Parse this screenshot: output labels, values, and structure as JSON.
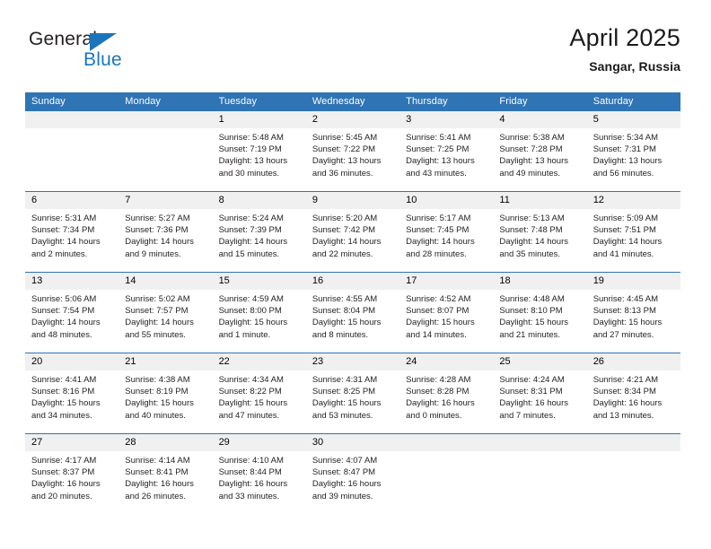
{
  "logo": {
    "word_top": "General",
    "word_bottom": "Blue",
    "triangle_color": "#1b75bb"
  },
  "header": {
    "title": "April 2025",
    "subtitle": "Sangar, Russia"
  },
  "colors": {
    "header_blue": "#2f74b5",
    "daynum_band": "#f0f0f0",
    "text": "#231f20"
  },
  "weekdays": [
    "Sunday",
    "Monday",
    "Tuesday",
    "Wednesday",
    "Thursday",
    "Friday",
    "Saturday"
  ],
  "labels": {
    "sunrise": "Sunrise:",
    "sunset": "Sunset:",
    "daylight": "Daylight:"
  },
  "weeks": [
    [
      {
        "day": "",
        "empty": true,
        "sunrise": "",
        "sunset": "",
        "daylight1": "",
        "daylight2": ""
      },
      {
        "day": "",
        "empty": true,
        "sunrise": "",
        "sunset": "",
        "daylight1": "",
        "daylight2": ""
      },
      {
        "day": "1",
        "sunrise": "Sunrise: 5:48 AM",
        "sunset": "Sunset: 7:19 PM",
        "daylight1": "Daylight: 13 hours",
        "daylight2": "and 30 minutes."
      },
      {
        "day": "2",
        "sunrise": "Sunrise: 5:45 AM",
        "sunset": "Sunset: 7:22 PM",
        "daylight1": "Daylight: 13 hours",
        "daylight2": "and 36 minutes."
      },
      {
        "day": "3",
        "sunrise": "Sunrise: 5:41 AM",
        "sunset": "Sunset: 7:25 PM",
        "daylight1": "Daylight: 13 hours",
        "daylight2": "and 43 minutes."
      },
      {
        "day": "4",
        "sunrise": "Sunrise: 5:38 AM",
        "sunset": "Sunset: 7:28 PM",
        "daylight1": "Daylight: 13 hours",
        "daylight2": "and 49 minutes."
      },
      {
        "day": "5",
        "sunrise": "Sunrise: 5:34 AM",
        "sunset": "Sunset: 7:31 PM",
        "daylight1": "Daylight: 13 hours",
        "daylight2": "and 56 minutes."
      }
    ],
    [
      {
        "day": "6",
        "sunrise": "Sunrise: 5:31 AM",
        "sunset": "Sunset: 7:34 PM",
        "daylight1": "Daylight: 14 hours",
        "daylight2": "and 2 minutes."
      },
      {
        "day": "7",
        "sunrise": "Sunrise: 5:27 AM",
        "sunset": "Sunset: 7:36 PM",
        "daylight1": "Daylight: 14 hours",
        "daylight2": "and 9 minutes."
      },
      {
        "day": "8",
        "sunrise": "Sunrise: 5:24 AM",
        "sunset": "Sunset: 7:39 PM",
        "daylight1": "Daylight: 14 hours",
        "daylight2": "and 15 minutes."
      },
      {
        "day": "9",
        "sunrise": "Sunrise: 5:20 AM",
        "sunset": "Sunset: 7:42 PM",
        "daylight1": "Daylight: 14 hours",
        "daylight2": "and 22 minutes."
      },
      {
        "day": "10",
        "sunrise": "Sunrise: 5:17 AM",
        "sunset": "Sunset: 7:45 PM",
        "daylight1": "Daylight: 14 hours",
        "daylight2": "and 28 minutes."
      },
      {
        "day": "11",
        "sunrise": "Sunrise: 5:13 AM",
        "sunset": "Sunset: 7:48 PM",
        "daylight1": "Daylight: 14 hours",
        "daylight2": "and 35 minutes."
      },
      {
        "day": "12",
        "sunrise": "Sunrise: 5:09 AM",
        "sunset": "Sunset: 7:51 PM",
        "daylight1": "Daylight: 14 hours",
        "daylight2": "and 41 minutes."
      }
    ],
    [
      {
        "day": "13",
        "sunrise": "Sunrise: 5:06 AM",
        "sunset": "Sunset: 7:54 PM",
        "daylight1": "Daylight: 14 hours",
        "daylight2": "and 48 minutes."
      },
      {
        "day": "14",
        "sunrise": "Sunrise: 5:02 AM",
        "sunset": "Sunset: 7:57 PM",
        "daylight1": "Daylight: 14 hours",
        "daylight2": "and 55 minutes."
      },
      {
        "day": "15",
        "sunrise": "Sunrise: 4:59 AM",
        "sunset": "Sunset: 8:00 PM",
        "daylight1": "Daylight: 15 hours",
        "daylight2": "and 1 minute."
      },
      {
        "day": "16",
        "sunrise": "Sunrise: 4:55 AM",
        "sunset": "Sunset: 8:04 PM",
        "daylight1": "Daylight: 15 hours",
        "daylight2": "and 8 minutes."
      },
      {
        "day": "17",
        "sunrise": "Sunrise: 4:52 AM",
        "sunset": "Sunset: 8:07 PM",
        "daylight1": "Daylight: 15 hours",
        "daylight2": "and 14 minutes."
      },
      {
        "day": "18",
        "sunrise": "Sunrise: 4:48 AM",
        "sunset": "Sunset: 8:10 PM",
        "daylight1": "Daylight: 15 hours",
        "daylight2": "and 21 minutes."
      },
      {
        "day": "19",
        "sunrise": "Sunrise: 4:45 AM",
        "sunset": "Sunset: 8:13 PM",
        "daylight1": "Daylight: 15 hours",
        "daylight2": "and 27 minutes."
      }
    ],
    [
      {
        "day": "20",
        "sunrise": "Sunrise: 4:41 AM",
        "sunset": "Sunset: 8:16 PM",
        "daylight1": "Daylight: 15 hours",
        "daylight2": "and 34 minutes."
      },
      {
        "day": "21",
        "sunrise": "Sunrise: 4:38 AM",
        "sunset": "Sunset: 8:19 PM",
        "daylight1": "Daylight: 15 hours",
        "daylight2": "and 40 minutes."
      },
      {
        "day": "22",
        "sunrise": "Sunrise: 4:34 AM",
        "sunset": "Sunset: 8:22 PM",
        "daylight1": "Daylight: 15 hours",
        "daylight2": "and 47 minutes."
      },
      {
        "day": "23",
        "sunrise": "Sunrise: 4:31 AM",
        "sunset": "Sunset: 8:25 PM",
        "daylight1": "Daylight: 15 hours",
        "daylight2": "and 53 minutes."
      },
      {
        "day": "24",
        "sunrise": "Sunrise: 4:28 AM",
        "sunset": "Sunset: 8:28 PM",
        "daylight1": "Daylight: 16 hours",
        "daylight2": "and 0 minutes."
      },
      {
        "day": "25",
        "sunrise": "Sunrise: 4:24 AM",
        "sunset": "Sunset: 8:31 PM",
        "daylight1": "Daylight: 16 hours",
        "daylight2": "and 7 minutes."
      },
      {
        "day": "26",
        "sunrise": "Sunrise: 4:21 AM",
        "sunset": "Sunset: 8:34 PM",
        "daylight1": "Daylight: 16 hours",
        "daylight2": "and 13 minutes."
      }
    ],
    [
      {
        "day": "27",
        "sunrise": "Sunrise: 4:17 AM",
        "sunset": "Sunset: 8:37 PM",
        "daylight1": "Daylight: 16 hours",
        "daylight2": "and 20 minutes."
      },
      {
        "day": "28",
        "sunrise": "Sunrise: 4:14 AM",
        "sunset": "Sunset: 8:41 PM",
        "daylight1": "Daylight: 16 hours",
        "daylight2": "and 26 minutes."
      },
      {
        "day": "29",
        "sunrise": "Sunrise: 4:10 AM",
        "sunset": "Sunset: 8:44 PM",
        "daylight1": "Daylight: 16 hours",
        "daylight2": "and 33 minutes."
      },
      {
        "day": "30",
        "sunrise": "Sunrise: 4:07 AM",
        "sunset": "Sunset: 8:47 PM",
        "daylight1": "Daylight: 16 hours",
        "daylight2": "and 39 minutes."
      },
      {
        "day": "",
        "empty": true,
        "sunrise": "",
        "sunset": "",
        "daylight1": "",
        "daylight2": ""
      },
      {
        "day": "",
        "empty": true,
        "sunrise": "",
        "sunset": "",
        "daylight1": "",
        "daylight2": ""
      },
      {
        "day": "",
        "empty": true,
        "sunrise": "",
        "sunset": "",
        "daylight1": "",
        "daylight2": ""
      }
    ]
  ]
}
